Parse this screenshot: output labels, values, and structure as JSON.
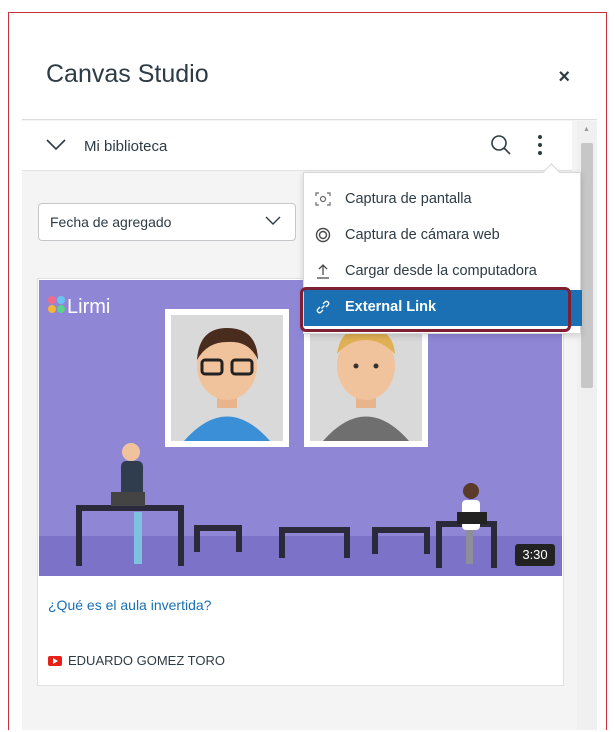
{
  "header": {
    "title": "Canvas Studio",
    "close_glyph": "×"
  },
  "library": {
    "name": "Mi biblioteca",
    "icons": [
      "chevron-down-icon",
      "search-icon",
      "more-vertical-icon"
    ]
  },
  "sort": {
    "selected": "Fecha de agregado"
  },
  "menu": {
    "items": [
      {
        "label": "Captura de pantalla",
        "icon": "screen-capture-icon"
      },
      {
        "label": "Captura de cámara web",
        "icon": "webcam-icon"
      },
      {
        "label": "Cargar desde la computadora",
        "icon": "upload-icon"
      },
      {
        "label": "External Link",
        "icon": "link-icon",
        "active": true
      }
    ]
  },
  "video": {
    "brand": "Lirmi",
    "duration": "3:30",
    "title": "¿Qué es el aula invertida?",
    "owner": "EDUARDO GOMEZ TORO"
  },
  "colors": {
    "accent": "#1a70b3",
    "highlight_ring": "#7f2032",
    "frame_border": "#c9303a",
    "thumbnail_bg": "#8f87d6"
  }
}
